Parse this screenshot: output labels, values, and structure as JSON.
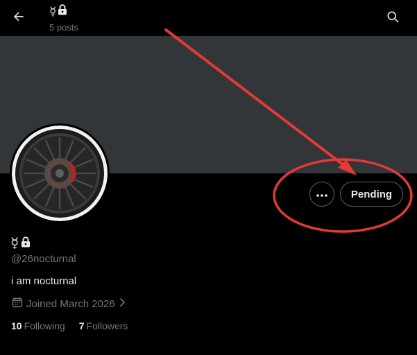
{
  "header": {
    "title_symbol": "☿",
    "posts_count": "5 posts"
  },
  "profile": {
    "display_symbol": "☿",
    "handle": "@26nocturnal",
    "bio": "i am nocturnal",
    "joined": "Joined March 2026",
    "following_count": "10",
    "following_label": "Following",
    "followers_count": "7",
    "followers_label": "Followers"
  },
  "actions": {
    "pending_label": "Pending"
  },
  "colors": {
    "background": "#000000",
    "banner": "#333639",
    "text_primary": "#e7e9ea",
    "text_secondary": "#71767b",
    "button_border": "#536471",
    "annotation": "#e53935"
  },
  "icons": [
    "back-arrow-icon",
    "lock-icon",
    "search-icon",
    "more-icon",
    "calendar-icon",
    "chevron-right-icon"
  ]
}
